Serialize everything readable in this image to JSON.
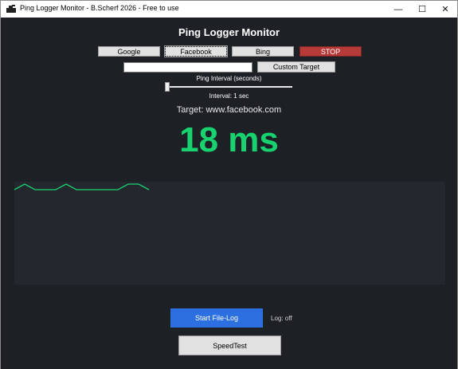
{
  "window": {
    "title": "Ping Logger Monitor - B.Scherf 2026 - Free to use",
    "minimize_glyph": "—",
    "maximize_glyph": "☐",
    "close_glyph": "✕",
    "icon": "app-icon"
  },
  "header": {
    "title": "Ping Logger Monitor"
  },
  "targets": {
    "google_label": "Google",
    "facebook_label": "Facebook",
    "bing_label": "Bing",
    "stop_label": "STOP",
    "custom_input_value": "",
    "custom_button_label": "Custom Target"
  },
  "interval": {
    "label": "Ping Interval (seconds)",
    "value_text": "Interval: 1 sec",
    "slider_fraction": 0.0
  },
  "status": {
    "target_text": "Target: www.facebook.com",
    "ping_text": "18 ms"
  },
  "graph": {
    "line_color": "#18d16f",
    "samples": [
      17,
      19,
      17,
      17,
      17,
      19,
      17,
      17,
      17,
      17,
      17,
      19,
      19,
      17
    ]
  },
  "footer": {
    "filelog_label": "Start File-Log",
    "log_status": "Log: off",
    "speedtest_label": "SpeedTest"
  },
  "colors": {
    "background": "#1d2025",
    "accent_green": "#18d16f",
    "stop_red": "#b53a38",
    "filelog_blue": "#2c6fe0"
  }
}
